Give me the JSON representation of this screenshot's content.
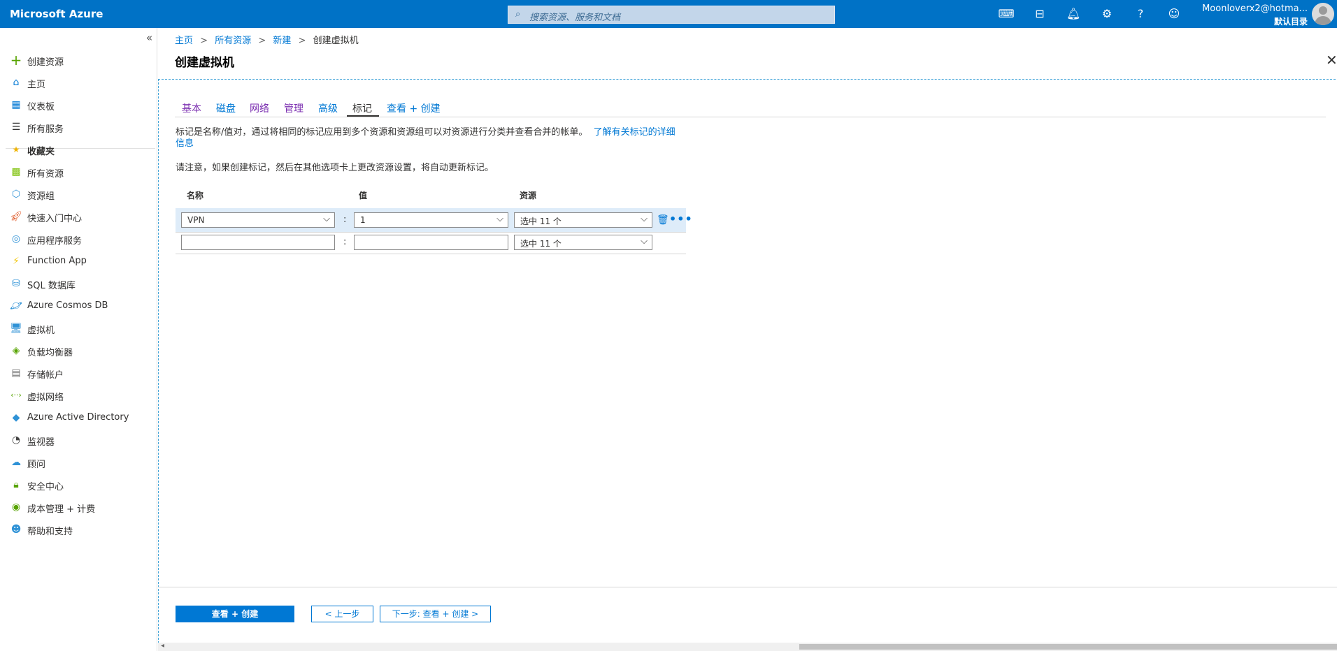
{
  "topbar": {
    "brand": "Microsoft Azure",
    "search_placeholder": "搜索资源、服务和文档",
    "account_email": "Moonloverx2@hotma...",
    "account_directory": "默认目录"
  },
  "sidebar": {
    "collapse_glyph": "«",
    "items": [
      {
        "label": "创建资源",
        "icon": "plus-icon"
      },
      {
        "label": "主页",
        "icon": "home-icon"
      },
      {
        "label": "仪表板",
        "icon": "dashboard-icon"
      },
      {
        "label": "所有服务",
        "icon": "list-icon"
      },
      {
        "label": "收藏夹",
        "icon": "star-icon"
      },
      {
        "label": "所有资源",
        "icon": "grid-icon"
      },
      {
        "label": "资源组",
        "icon": "resource-group-icon"
      },
      {
        "label": "快速入门中心",
        "icon": "rocket-icon"
      },
      {
        "label": "应用程序服务",
        "icon": "app-service-icon"
      },
      {
        "label": "Function App",
        "icon": "function-icon"
      },
      {
        "label": "SQL 数据库",
        "icon": "sql-icon"
      },
      {
        "label": "Azure Cosmos DB",
        "icon": "cosmos-icon"
      },
      {
        "label": "虚拟机",
        "icon": "vm-icon"
      },
      {
        "label": "负载均衡器",
        "icon": "load-balancer-icon"
      },
      {
        "label": "存储帐户",
        "icon": "storage-icon"
      },
      {
        "label": "虚拟网络",
        "icon": "vnet-icon"
      },
      {
        "label": "Azure Active Directory",
        "icon": "aad-icon"
      },
      {
        "label": "监视器",
        "icon": "monitor-icon"
      },
      {
        "label": "顾问",
        "icon": "advisor-icon"
      },
      {
        "label": "安全中心",
        "icon": "security-icon"
      },
      {
        "label": "成本管理 + 计费",
        "icon": "cost-icon"
      },
      {
        "label": "帮助和支持",
        "icon": "help-icon"
      }
    ]
  },
  "breadcrumb": {
    "items": [
      "主页",
      "所有资源",
      "新建",
      "创建虚拟机"
    ],
    "separator": ">"
  },
  "page": {
    "title": "创建虚拟机",
    "close_glyph": "✕"
  },
  "tabs": [
    {
      "label": "基本"
    },
    {
      "label": "磁盘"
    },
    {
      "label": "网络"
    },
    {
      "label": "管理"
    },
    {
      "label": "高级"
    },
    {
      "label": "标记"
    },
    {
      "label": "查看 + 创建"
    }
  ],
  "tags_page": {
    "description": "标记是名称/值对，通过将相同的标记应用到多个资源和资源组可以对资源进行分类并查看合并的帐单。",
    "learn_more": "了解有关标记的详细信息",
    "note": "请注意，如果创建标记，然后在其他选项卡上更改资源设置，将自动更新标记。",
    "columns": {
      "name": "名称",
      "value": "值",
      "resource": "资源"
    },
    "rows": [
      {
        "name": "VPN",
        "value": "1",
        "resource": "选中 11 个"
      },
      {
        "name": "",
        "value": "",
        "resource": "选中 11 个"
      }
    ],
    "colon": ":",
    "more_glyph": "•••"
  },
  "footer": {
    "review_create": "查看 + 创建",
    "previous": "< 上一步",
    "next": "下一步: 查看 + 创建 >"
  },
  "colors": {
    "topbar": "#0072c6",
    "accent": "#0078d4",
    "selected_row": "#deecf9"
  }
}
